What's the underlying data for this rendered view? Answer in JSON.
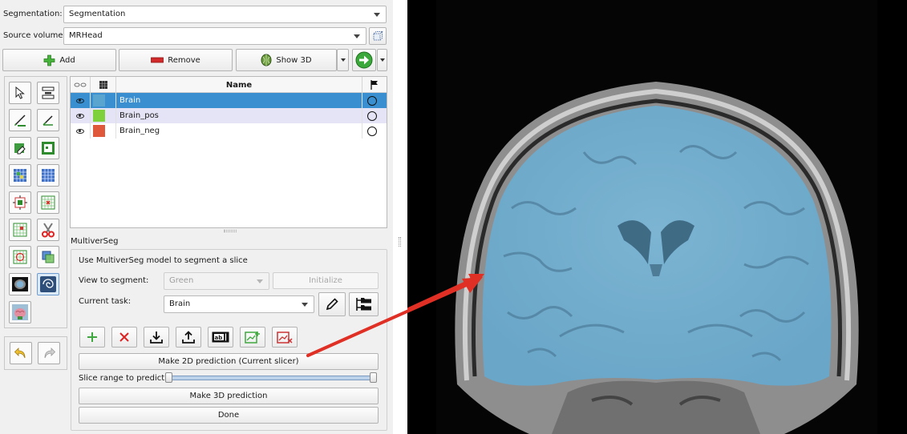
{
  "segmentation_row": {
    "label": "Segmentation:",
    "value": "Segmentation"
  },
  "source_row": {
    "label": "Source volume:",
    "value": "MRHead"
  },
  "toolbar": {
    "add_label": "Add",
    "remove_label": "Remove",
    "show3d_label": "Show 3D"
  },
  "table": {
    "header_name": "Name",
    "rows": [
      {
        "name": "Brain",
        "color": "#5aa5cf",
        "selected": true
      },
      {
        "name": "Brain_pos",
        "color": "#7fd13b",
        "selected": false
      },
      {
        "name": "Brain_neg",
        "color": "#e0583b",
        "selected": false
      }
    ]
  },
  "module": {
    "title": "MultiverSeg",
    "description": "Use MultiverSeg model to segment a slice",
    "view_label": "View to segment:",
    "view_value": "Green",
    "initialize_label": "Initialize",
    "task_label": "Current task:",
    "task_value": "Brain",
    "predict_2d_label": "Make 2D prediction (Current slicer)",
    "slice_range_label": "Slice range to predict:",
    "slice_range": [
      0,
      1
    ],
    "predict_3d_label": "Make 3D prediction",
    "done_label": "Done"
  },
  "colors": {
    "selection": "#3a8fd0",
    "overlay": "#6fb3d8",
    "annotation_arrow": "#e03025"
  }
}
